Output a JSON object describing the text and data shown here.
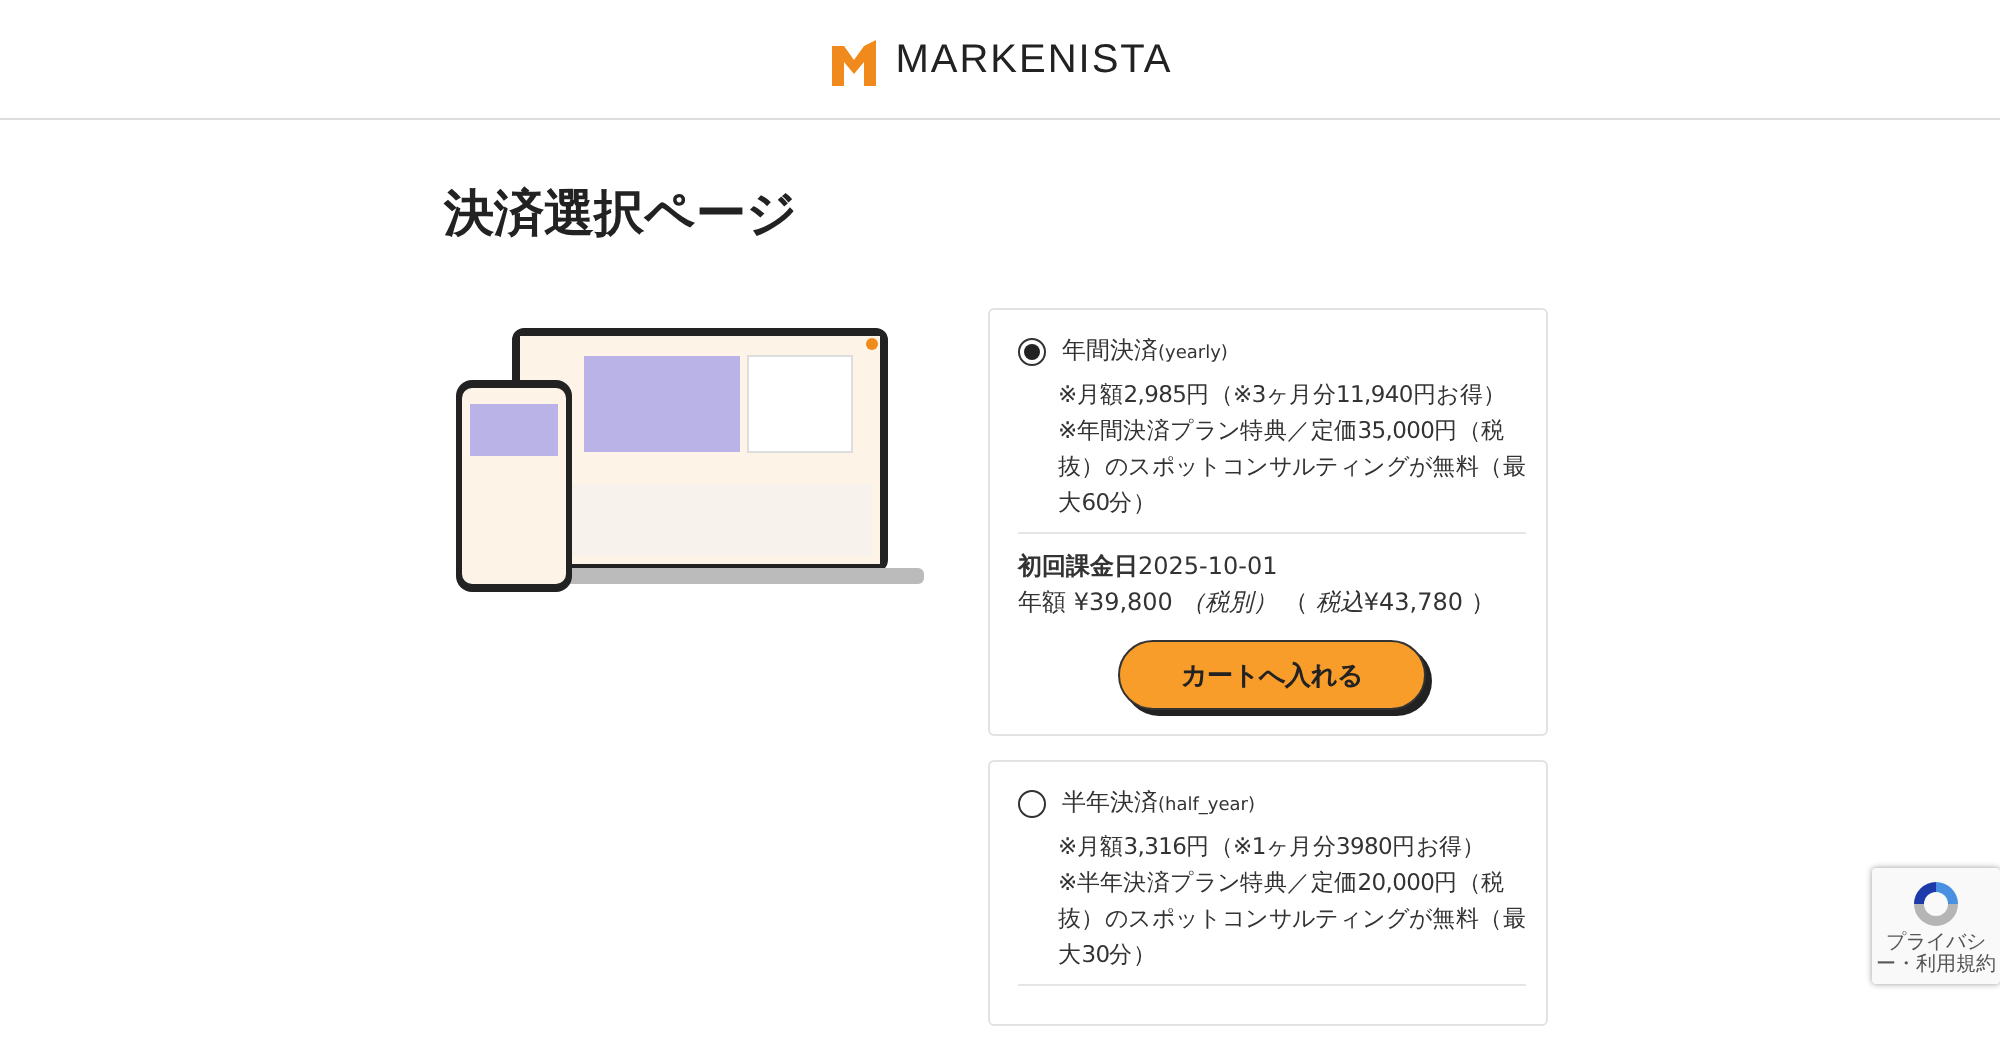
{
  "header": {
    "logo_text": "MARKENISTA"
  },
  "page_title": "決済選択ページ",
  "plans": [
    {
      "selected": true,
      "name": "年間決済",
      "code": "(yearly)",
      "notes": [
        "※月額2,985円（※3ヶ月分11,940円お得）",
        "※年間決済プラン特典／定価35,000円（税抜）のスポットコンサルティングが無料（最大60分）"
      ],
      "billing_label": "初回課金日",
      "billing_date": "2025-10-01",
      "price_line": "年額 ¥39,800 *（税別）* （ *税込*¥43,780 ）",
      "cart_button": "カートへ入れる"
    },
    {
      "selected": false,
      "name": "半年決済",
      "code": "(half_year)",
      "notes": [
        "※月額3,316円（※1ヶ月分3980円お得）",
        "※半年決済プラン特典／定価20,000円（税抜）のスポットコンサルティングが無料（最大30分）"
      ]
    }
  ],
  "recaptcha": {
    "text": "プライバシー・利用規約"
  }
}
